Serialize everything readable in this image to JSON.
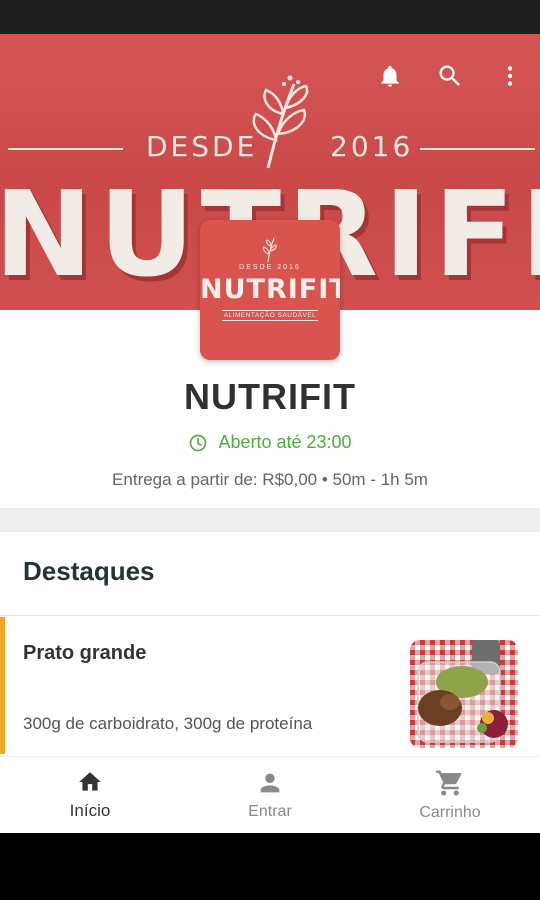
{
  "banner": {
    "since_left": "DESDE",
    "since_right": "2016",
    "brand_text": "NUTRIFIT"
  },
  "toolbar": {
    "icons": [
      "bell-icon",
      "search-icon",
      "more-vert-icon"
    ]
  },
  "logo": {
    "since_text": "DESDE   2016",
    "name": "NUTRIFIT",
    "tagline": "ALIMENTAÇÃO SAUDÁVEL"
  },
  "store": {
    "name": "NUTRIFIT",
    "open_status": "Aberto até 23:00",
    "delivery_info": "Entrega a partir de: R$0,00 • 50m - 1h 5m"
  },
  "section": {
    "title": "Destaques"
  },
  "product": {
    "name": "Prato grande",
    "description": "300g de carboidrato, 300g de proteína"
  },
  "bottom_nav": {
    "items": [
      {
        "label": "Início",
        "icon": "home-icon",
        "active": true
      },
      {
        "label": "Entrar",
        "icon": "person-icon",
        "active": false
      },
      {
        "label": "Carrinho",
        "icon": "cart-icon",
        "active": false
      }
    ]
  },
  "colors": {
    "brand_red": "#d65656",
    "open_green": "#4caf3a",
    "accent_orange": "#f5a623"
  }
}
